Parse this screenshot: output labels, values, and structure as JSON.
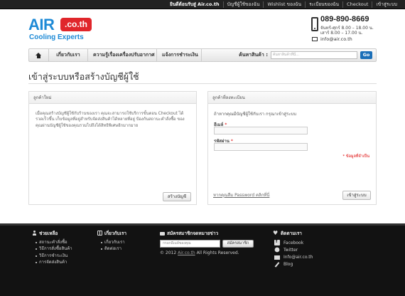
{
  "topbar": {
    "links": [
      "ยินดีต้อนรับสู่ Air.co.th",
      "บัญชีผู้ใช้ของฉัน",
      "Wishlist ของฉัน",
      "ระเบียนของฉัน",
      "Checkout",
      "เข้าสู่ระบบ"
    ]
  },
  "logo": {
    "air": "AIR",
    "badge": ".co.th",
    "tagline": "Cooling Experts"
  },
  "contact": {
    "phone": "089-890-8669",
    "hours1": "จันทร์-ศุกร์ 8.00 – 18.00 น.",
    "hours2": "เสาร์ 8.00 – 17.00 น.",
    "email": "info@air.co.th"
  },
  "nav": {
    "items": [
      "เกี่ยวกับเรา",
      "ความรู้เรื่องเครื่องปรับอากาศ",
      "แจ้งการชำระเงิน"
    ],
    "search_label": "ค้นหาสินค้า :",
    "search_placeholder": "ค้นหาสินค้าที่นี่...",
    "go": "Go"
  },
  "page": {
    "title": "เข้าสู่ระบบหรือสร้างบัญชีผู้ใช้"
  },
  "new_customer": {
    "heading": "ลูกค้าใหม่",
    "text": "เมื่อคุณสร้างบัญชีผู้ใช้กับร้านของเรา คุณจะสามารถใช้บริการขั้นตอน Checkout ได้รวดเร็วขึ้น เก็บข้อมูลที่อยู่สำหรับจัดส่งสินค้าได้หลายที่อยู่ ป้องกันสถานะคำสั่งซื้อ ของคุณผ่านบัญชีผู้ใช้ของคุณรวมไปถึงได้สิทธิพิเศษอีกมากมาย",
    "button": "สร้างบัญชี"
  },
  "registered": {
    "heading": "ลูกค้าที่ลงทะเบียน",
    "intro": "ถ้าหากคุณมีบัญชีผู้ใช้กับเรา กรุณาเข้าสู่ระบบ",
    "email_label": "อีเมล์",
    "password_label": "รหัสผ่าน",
    "required_mark": "*",
    "required_note": "* ข้อมูลที่จำเป็น",
    "forgot": "หากคุณลืม Password คลิกที่นี่",
    "button": "เข้าสู่ระบบ"
  },
  "footer": {
    "help": {
      "heading": "ช่วยเหลือ",
      "items": [
        "สถานะคำสั่งซื้อ",
        "วิธีการสั่งซื้อสินค้า",
        "วิธีการชำระเงิน",
        "การจัดส่งสินค้า"
      ]
    },
    "about": {
      "heading": "เกี่ยวกับเรา",
      "items": [
        "เกี่ยวกับเรา",
        "ติดต่อเรา"
      ]
    },
    "newsletter": {
      "heading": "สมัครสมาชิกจดหมายข่าว",
      "placeholder": "กรอกอีเมล์ของคุณ",
      "button": "สมัครสมาชิก",
      "copyright_prefix": "© 2012",
      "copyright_link": "Air.co.th",
      "copyright_suffix": "All Rights Reserved."
    },
    "contact": {
      "heading": "ติดตามเรา",
      "facebook": "Facebook",
      "twitter": "Twitter",
      "email": "Info@air.co.th",
      "blog": "Blog"
    }
  }
}
